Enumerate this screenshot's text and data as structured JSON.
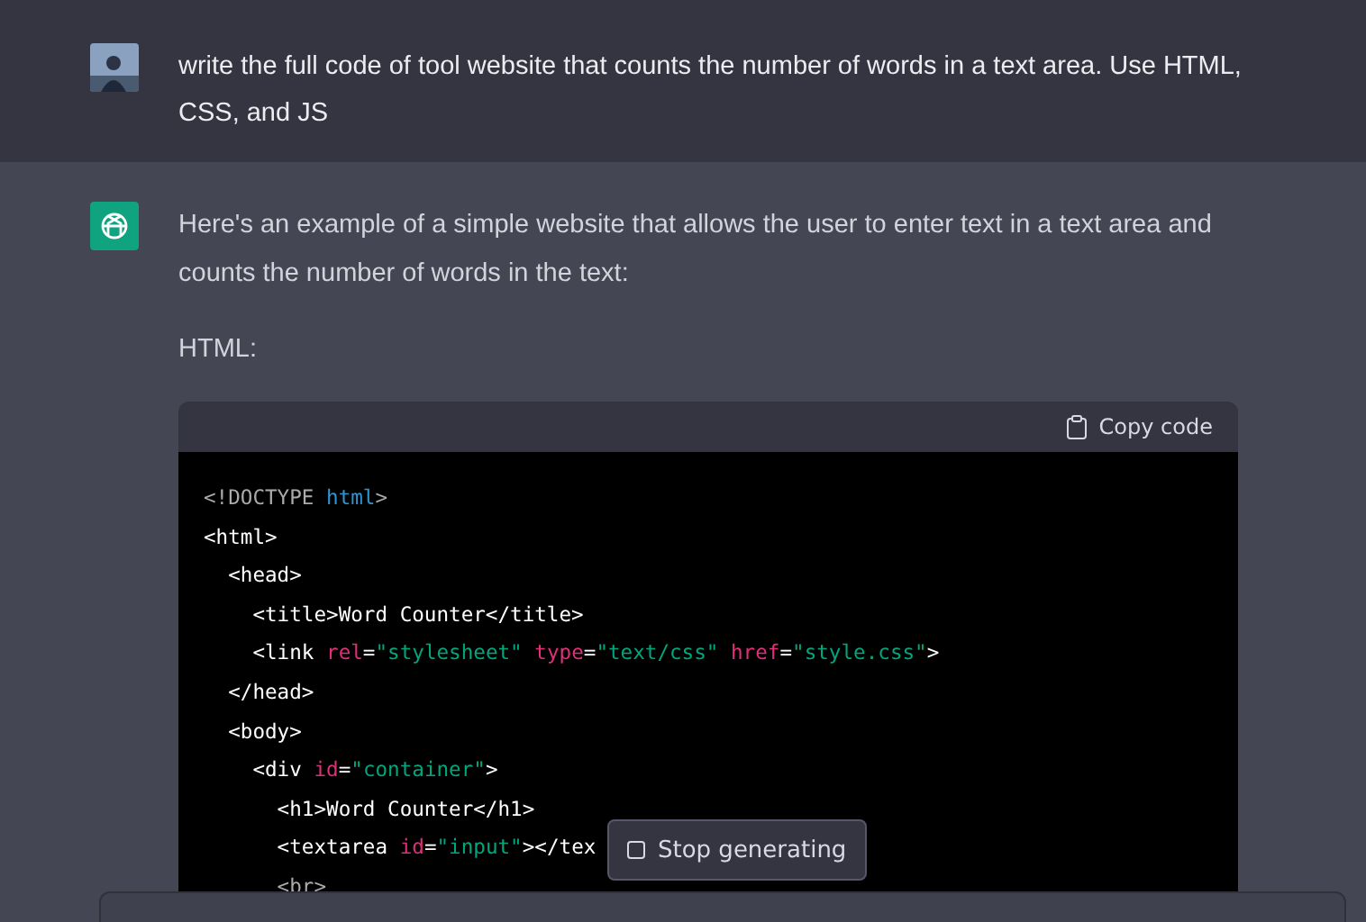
{
  "messages": [
    {
      "kind": "user",
      "text": "write the full code of tool website that counts the number of words in a text area. Use HTML, CSS, and JS"
    },
    {
      "kind": "assistant",
      "paragraphs": [
        "Here's an example of a simple website that allows the user to enter text in a text area and counts the number of words in the text:",
        "HTML:"
      ],
      "code_block": {
        "copy_button": "Copy code",
        "lines": [
          [
            {
              "kind": "dim",
              "text": "<!DOCTYPE "
            },
            {
              "kind": "keyword",
              "text": "html"
            },
            {
              "kind": "dim",
              "text": ">"
            }
          ],
          [
            {
              "kind": "tag",
              "text": "<html>"
            }
          ],
          [
            {
              "kind": "tag",
              "text": "  <head>"
            }
          ],
          [
            {
              "kind": "tag",
              "text": "    <title>Word Counter</title>"
            }
          ],
          [
            {
              "kind": "tag",
              "text": "    <link "
            },
            {
              "kind": "attr",
              "text": "rel"
            },
            {
              "kind": "tag",
              "text": "="
            },
            {
              "kind": "str",
              "text": "\"stylesheet\""
            },
            {
              "kind": "attr",
              "text": " type"
            },
            {
              "kind": "tag",
              "text": "="
            },
            {
              "kind": "str",
              "text": "\"text/css\""
            },
            {
              "kind": "attr",
              "text": " href"
            },
            {
              "kind": "tag",
              "text": "="
            },
            {
              "kind": "str",
              "text": "\"style.css\""
            },
            {
              "kind": "tag",
              "text": ">"
            }
          ],
          [
            {
              "kind": "tag",
              "text": "  </head>"
            }
          ],
          [
            {
              "kind": "tag",
              "text": "  <body>"
            }
          ],
          [
            {
              "kind": "tag",
              "text": "    <div "
            },
            {
              "kind": "attr",
              "text": "id"
            },
            {
              "kind": "tag",
              "text": "="
            },
            {
              "kind": "str",
              "text": "\"container\""
            },
            {
              "kind": "tag",
              "text": ">"
            }
          ],
          [
            {
              "kind": "tag",
              "text": "      <h1>Word Counter</h1>"
            }
          ],
          [
            {
              "kind": "tag",
              "text": "      <textarea "
            },
            {
              "kind": "attr",
              "text": "id"
            },
            {
              "kind": "tag",
              "text": "="
            },
            {
              "kind": "str",
              "text": "\"input\""
            },
            {
              "kind": "tag",
              "text": "></tex"
            }
          ],
          [
            {
              "kind": "dim",
              "text": "      <br>"
            }
          ]
        ]
      }
    }
  ],
  "stop_button": "Stop generating"
}
